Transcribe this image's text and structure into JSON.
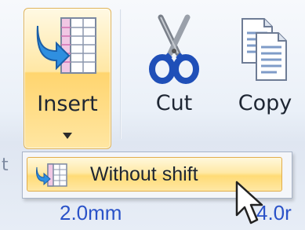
{
  "ribbon": {
    "insert": {
      "label": "Insert",
      "icon": "insert-cells-icon",
      "has_dropdown": true
    },
    "cut": {
      "label": "Cut",
      "icon": "scissors-icon"
    },
    "copy": {
      "label": "Copy",
      "icon": "copy-icon"
    },
    "partial_left_text": "t"
  },
  "dropdown": {
    "items": [
      {
        "label": "Without shift",
        "icon": "insert-without-shift-icon",
        "highlighted": true
      }
    ]
  },
  "status": {
    "left_value": "2.0mm",
    "right_value_partial": "4.0r"
  },
  "colors": {
    "highlight": "#ffdb76",
    "status_text": "#2a52c8",
    "accent_blue": "#2f6fd6"
  }
}
